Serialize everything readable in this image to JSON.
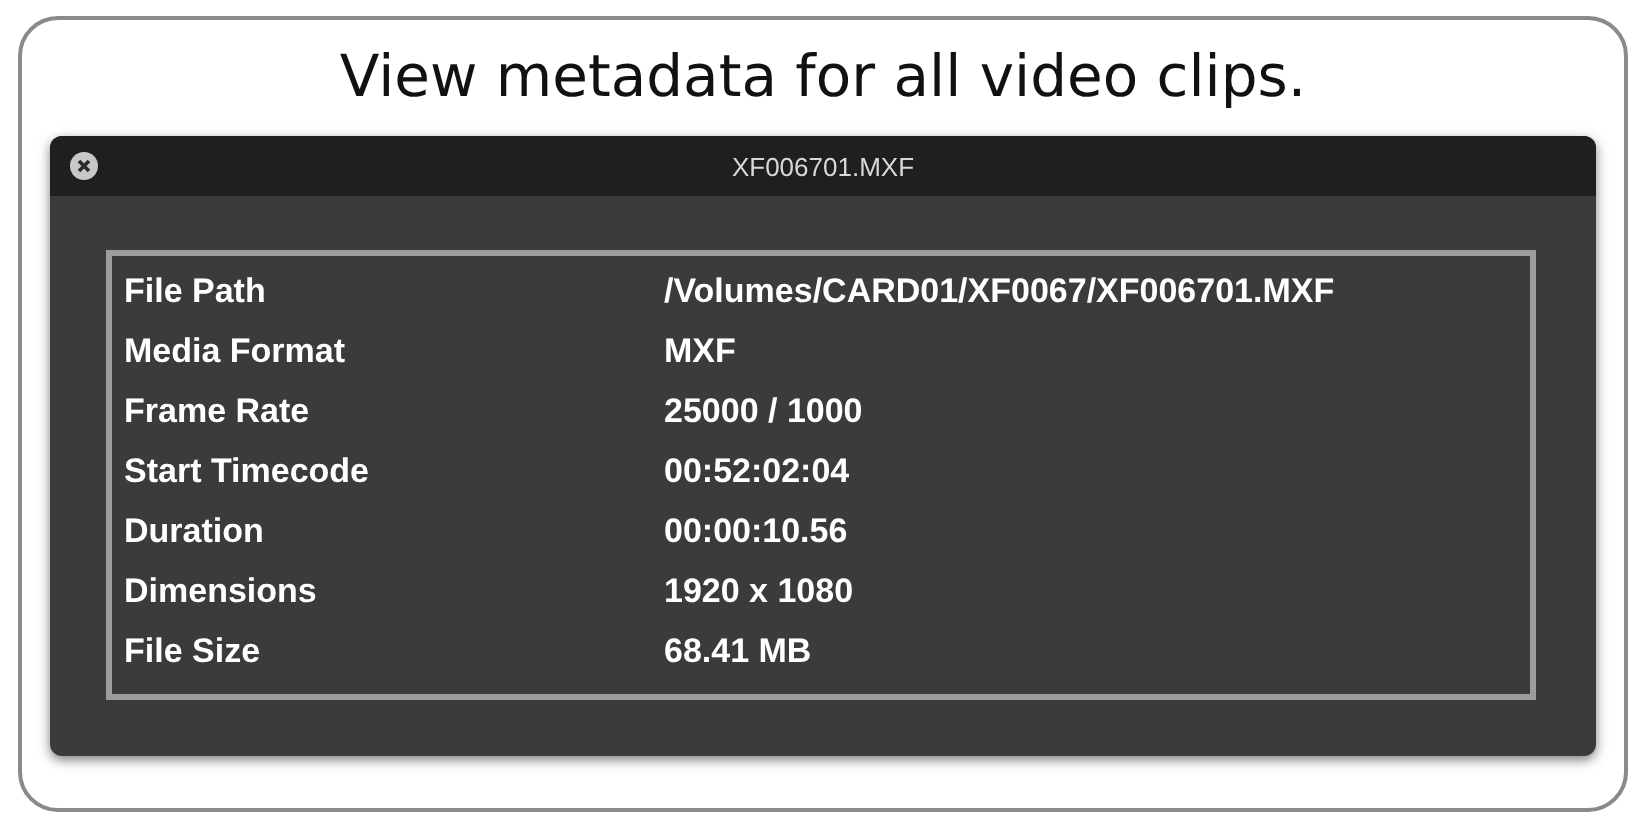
{
  "heading": "View metadata for all video clips.",
  "window": {
    "title": "XF006701.MXF"
  },
  "metadata": [
    {
      "label": "File Path",
      "value": "/Volumes/CARD01/XF0067/XF006701.MXF"
    },
    {
      "label": "Media Format",
      "value": "MXF"
    },
    {
      "label": "Frame Rate",
      "value": "25000 / 1000"
    },
    {
      "label": "Start Timecode",
      "value": "00:52:02:04"
    },
    {
      "label": "Duration",
      "value": "00:00:10.56"
    },
    {
      "label": "Dimensions",
      "value": "1920 x 1080"
    },
    {
      "label": "File Size",
      "value": "68.41 MB"
    }
  ]
}
